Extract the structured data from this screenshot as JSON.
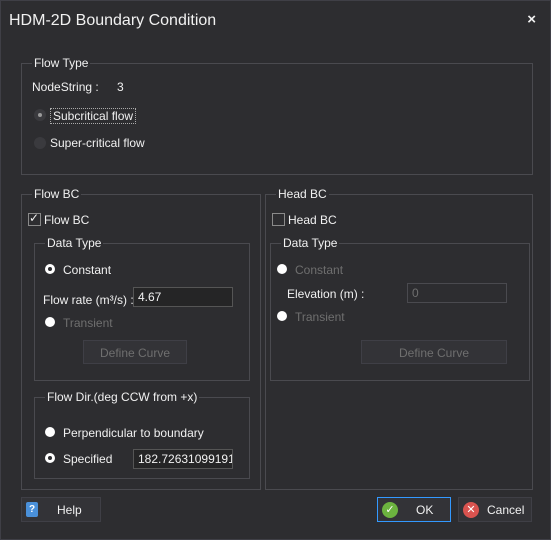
{
  "window": {
    "title": "HDM-2D Boundary Condition",
    "close_icon": "×"
  },
  "flow_type": {
    "title": "Flow Type",
    "nodestring_label": "NodeString :",
    "nodestring_value": "3",
    "options": [
      "Subcritical flow",
      "Super-critical flow"
    ],
    "selected": "Subcritical flow"
  },
  "flow_bc": {
    "title": "Flow BC",
    "checkbox_label": "Flow BC",
    "checked": true,
    "data_type": {
      "title": "Data Type",
      "constant_label": "Constant",
      "flow_rate_label": "Flow rate (m³/s) :",
      "flow_rate_value": "4.67",
      "transient_label": "Transient",
      "define_curve_label": "Define Curve"
    },
    "flow_dir": {
      "title": "Flow Dir.(deg CCW from +x)",
      "perpendicular_label": "Perpendicular to boundary",
      "specified_label": "Specified",
      "specified_value": "182.72631099191"
    }
  },
  "head_bc": {
    "title": "Head BC",
    "checkbox_label": "Head BC",
    "checked": false,
    "data_type": {
      "title": "Data Type",
      "constant_label": "Constant",
      "elevation_label": "Elevation (m) :",
      "elevation_value": "0",
      "transient_label": "Transient",
      "define_curve_label": "Define Curve"
    }
  },
  "buttons": {
    "help": "Help",
    "ok": "OK",
    "cancel": "Cancel"
  },
  "colors": {
    "background": "#2d2d30",
    "border": "#4a4a4f",
    "accent": "#3399ff",
    "disabled_text": "#6f6f6f"
  }
}
